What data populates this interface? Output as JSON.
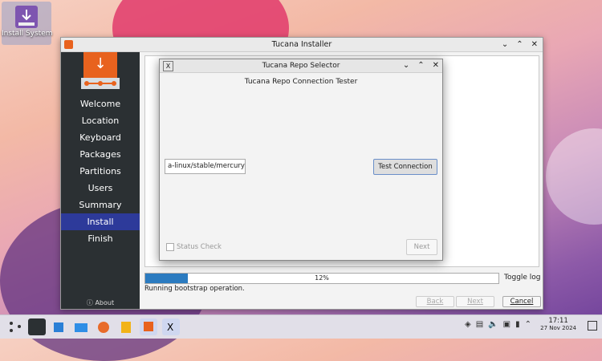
{
  "desktop": {
    "icon_label": "Install System"
  },
  "installer": {
    "title": "Tucana Installer",
    "nav": [
      "Welcome",
      "Location",
      "Keyboard",
      "Packages",
      "Partitions",
      "Users",
      "Summary",
      "Install",
      "Finish"
    ],
    "active_nav": "Install",
    "about": "About",
    "progress": {
      "value": 0.12,
      "label": "12%"
    },
    "toggle_log": "Toggle log",
    "status": "Running bootstrap operation.",
    "back_label": "Back",
    "next_label": "Next",
    "cancel_label": "Cancel"
  },
  "dialog": {
    "title": "Tucana Repo Selector",
    "subtitle": "Tucana Repo Connection Tester",
    "url_value": "a-linux/stable/mercury/",
    "test_button": "Test Connection",
    "status_check": "Status Check",
    "next_label": "Next"
  },
  "taskbar": {
    "time": "17:11",
    "date": "27 Nov 2024"
  },
  "colors": {
    "accent": "#e8621e",
    "active_nav": "#2d3a9a",
    "progress": "#2b7bc0"
  }
}
